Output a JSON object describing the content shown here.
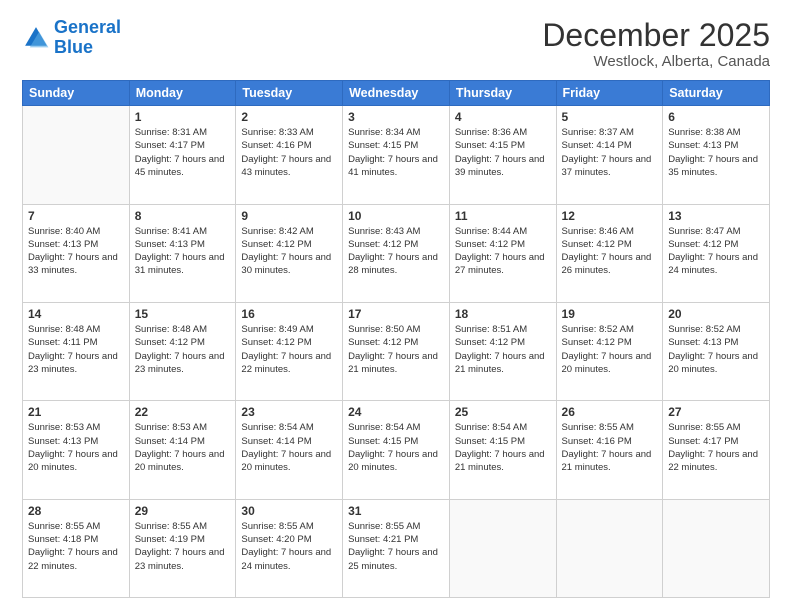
{
  "logo": {
    "line1": "General",
    "line2": "Blue"
  },
  "title": "December 2025",
  "subtitle": "Westlock, Alberta, Canada",
  "header_days": [
    "Sunday",
    "Monday",
    "Tuesday",
    "Wednesday",
    "Thursday",
    "Friday",
    "Saturday"
  ],
  "weeks": [
    [
      {
        "date": "",
        "sunrise": "",
        "sunset": "",
        "daylight": ""
      },
      {
        "date": "1",
        "sunrise": "Sunrise: 8:31 AM",
        "sunset": "Sunset: 4:17 PM",
        "daylight": "Daylight: 7 hours and 45 minutes."
      },
      {
        "date": "2",
        "sunrise": "Sunrise: 8:33 AM",
        "sunset": "Sunset: 4:16 PM",
        "daylight": "Daylight: 7 hours and 43 minutes."
      },
      {
        "date": "3",
        "sunrise": "Sunrise: 8:34 AM",
        "sunset": "Sunset: 4:15 PM",
        "daylight": "Daylight: 7 hours and 41 minutes."
      },
      {
        "date": "4",
        "sunrise": "Sunrise: 8:36 AM",
        "sunset": "Sunset: 4:15 PM",
        "daylight": "Daylight: 7 hours and 39 minutes."
      },
      {
        "date": "5",
        "sunrise": "Sunrise: 8:37 AM",
        "sunset": "Sunset: 4:14 PM",
        "daylight": "Daylight: 7 hours and 37 minutes."
      },
      {
        "date": "6",
        "sunrise": "Sunrise: 8:38 AM",
        "sunset": "Sunset: 4:13 PM",
        "daylight": "Daylight: 7 hours and 35 minutes."
      }
    ],
    [
      {
        "date": "7",
        "sunrise": "Sunrise: 8:40 AM",
        "sunset": "Sunset: 4:13 PM",
        "daylight": "Daylight: 7 hours and 33 minutes."
      },
      {
        "date": "8",
        "sunrise": "Sunrise: 8:41 AM",
        "sunset": "Sunset: 4:13 PM",
        "daylight": "Daylight: 7 hours and 31 minutes."
      },
      {
        "date": "9",
        "sunrise": "Sunrise: 8:42 AM",
        "sunset": "Sunset: 4:12 PM",
        "daylight": "Daylight: 7 hours and 30 minutes."
      },
      {
        "date": "10",
        "sunrise": "Sunrise: 8:43 AM",
        "sunset": "Sunset: 4:12 PM",
        "daylight": "Daylight: 7 hours and 28 minutes."
      },
      {
        "date": "11",
        "sunrise": "Sunrise: 8:44 AM",
        "sunset": "Sunset: 4:12 PM",
        "daylight": "Daylight: 7 hours and 27 minutes."
      },
      {
        "date": "12",
        "sunrise": "Sunrise: 8:46 AM",
        "sunset": "Sunset: 4:12 PM",
        "daylight": "Daylight: 7 hours and 26 minutes."
      },
      {
        "date": "13",
        "sunrise": "Sunrise: 8:47 AM",
        "sunset": "Sunset: 4:12 PM",
        "daylight": "Daylight: 7 hours and 24 minutes."
      }
    ],
    [
      {
        "date": "14",
        "sunrise": "Sunrise: 8:48 AM",
        "sunset": "Sunset: 4:11 PM",
        "daylight": "Daylight: 7 hours and 23 minutes."
      },
      {
        "date": "15",
        "sunrise": "Sunrise: 8:48 AM",
        "sunset": "Sunset: 4:12 PM",
        "daylight": "Daylight: 7 hours and 23 minutes."
      },
      {
        "date": "16",
        "sunrise": "Sunrise: 8:49 AM",
        "sunset": "Sunset: 4:12 PM",
        "daylight": "Daylight: 7 hours and 22 minutes."
      },
      {
        "date": "17",
        "sunrise": "Sunrise: 8:50 AM",
        "sunset": "Sunset: 4:12 PM",
        "daylight": "Daylight: 7 hours and 21 minutes."
      },
      {
        "date": "18",
        "sunrise": "Sunrise: 8:51 AM",
        "sunset": "Sunset: 4:12 PM",
        "daylight": "Daylight: 7 hours and 21 minutes."
      },
      {
        "date": "19",
        "sunrise": "Sunrise: 8:52 AM",
        "sunset": "Sunset: 4:12 PM",
        "daylight": "Daylight: 7 hours and 20 minutes."
      },
      {
        "date": "20",
        "sunrise": "Sunrise: 8:52 AM",
        "sunset": "Sunset: 4:13 PM",
        "daylight": "Daylight: 7 hours and 20 minutes."
      }
    ],
    [
      {
        "date": "21",
        "sunrise": "Sunrise: 8:53 AM",
        "sunset": "Sunset: 4:13 PM",
        "daylight": "Daylight: 7 hours and 20 minutes."
      },
      {
        "date": "22",
        "sunrise": "Sunrise: 8:53 AM",
        "sunset": "Sunset: 4:14 PM",
        "daylight": "Daylight: 7 hours and 20 minutes."
      },
      {
        "date": "23",
        "sunrise": "Sunrise: 8:54 AM",
        "sunset": "Sunset: 4:14 PM",
        "daylight": "Daylight: 7 hours and 20 minutes."
      },
      {
        "date": "24",
        "sunrise": "Sunrise: 8:54 AM",
        "sunset": "Sunset: 4:15 PM",
        "daylight": "Daylight: 7 hours and 20 minutes."
      },
      {
        "date": "25",
        "sunrise": "Sunrise: 8:54 AM",
        "sunset": "Sunset: 4:15 PM",
        "daylight": "Daylight: 7 hours and 21 minutes."
      },
      {
        "date": "26",
        "sunrise": "Sunrise: 8:55 AM",
        "sunset": "Sunset: 4:16 PM",
        "daylight": "Daylight: 7 hours and 21 minutes."
      },
      {
        "date": "27",
        "sunrise": "Sunrise: 8:55 AM",
        "sunset": "Sunset: 4:17 PM",
        "daylight": "Daylight: 7 hours and 22 minutes."
      }
    ],
    [
      {
        "date": "28",
        "sunrise": "Sunrise: 8:55 AM",
        "sunset": "Sunset: 4:18 PM",
        "daylight": "Daylight: 7 hours and 22 minutes."
      },
      {
        "date": "29",
        "sunrise": "Sunrise: 8:55 AM",
        "sunset": "Sunset: 4:19 PM",
        "daylight": "Daylight: 7 hours and 23 minutes."
      },
      {
        "date": "30",
        "sunrise": "Sunrise: 8:55 AM",
        "sunset": "Sunset: 4:20 PM",
        "daylight": "Daylight: 7 hours and 24 minutes."
      },
      {
        "date": "31",
        "sunrise": "Sunrise: 8:55 AM",
        "sunset": "Sunset: 4:21 PM",
        "daylight": "Daylight: 7 hours and 25 minutes."
      },
      {
        "date": "",
        "sunrise": "",
        "sunset": "",
        "daylight": ""
      },
      {
        "date": "",
        "sunrise": "",
        "sunset": "",
        "daylight": ""
      },
      {
        "date": "",
        "sunrise": "",
        "sunset": "",
        "daylight": ""
      }
    ]
  ]
}
